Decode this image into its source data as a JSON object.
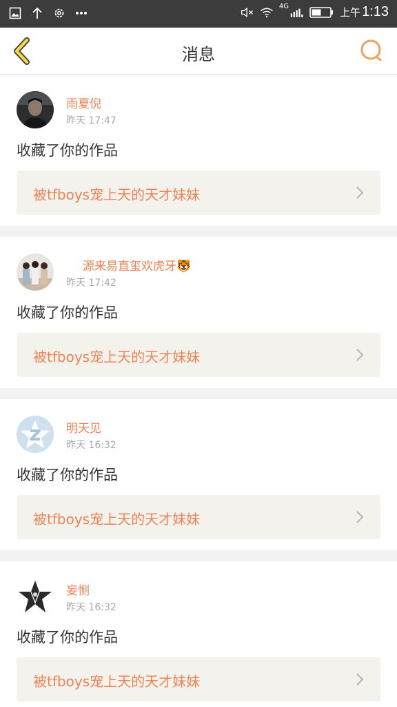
{
  "status_bar": {
    "left_icons": [
      "image-icon",
      "upload-arrow-icon",
      "gear-icon",
      "more-dots-icon"
    ],
    "network": "4G",
    "ampm": "上午",
    "time": "1:13"
  },
  "header": {
    "title": "消息",
    "accent_color": "#f0a263"
  },
  "messages": [
    {
      "user": "雨夏倪",
      "time": "昨天 17:47",
      "action": "收藏了你的作品",
      "work": "被tfboys宠上天的天才妹妹",
      "avatar": "photo-avatar"
    },
    {
      "user": "源来易直玺欢虎牙",
      "emoji": "🐯",
      "time": "昨天 17:42",
      "action": "收藏了你的作品",
      "work": "被tfboys宠上天的天才妹妹",
      "avatar": "group-photo-avatar"
    },
    {
      "user": "明天见",
      "time": "昨天 16:32",
      "action": "收藏了你的作品",
      "work": "被tfboys宠上天的天才妹妹",
      "avatar": "default-qzone-avatar"
    },
    {
      "user": "妄恻",
      "time": "昨天 16:32",
      "action": "收藏了你的作品",
      "work": "被tfboys宠上天的天才妹妹",
      "avatar": "pentagram-goat-avatar"
    }
  ]
}
